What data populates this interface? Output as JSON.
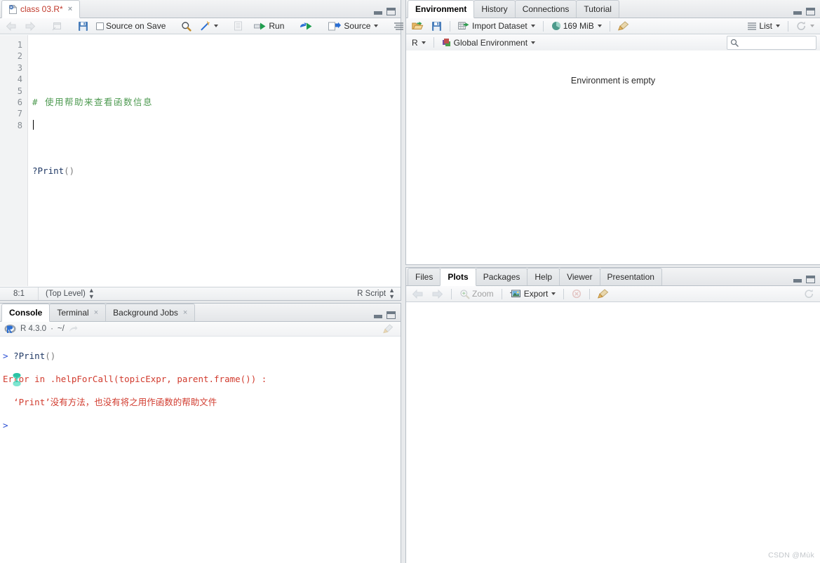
{
  "source": {
    "tab": {
      "label": "class 03.R*",
      "icon": "r-file-icon",
      "close": "×"
    },
    "toolbar": {
      "back": "back-arrow",
      "forward": "forward-arrow",
      "popout": "show-in-new-window",
      "save": "save-icon",
      "source_on_save_label": "Source on Save",
      "find": "magnifier-icon",
      "codetools": "magic-wand-icon",
      "compile_report": "compile-report-icon",
      "run_label": "Run",
      "rerun": "rerun-icon",
      "source_label": "Source",
      "outline": "outline-icon"
    },
    "gutter_lines": [
      "1",
      "2",
      "3",
      "4",
      "5",
      "6",
      "7",
      "8"
    ],
    "code": {
      "line2_comment": "# 使用帮助来查看函数信息",
      "line4_fn": "?Print",
      "line4_paren": "()"
    },
    "status": {
      "position": "8:1",
      "scope": "(Top Level)",
      "filetype": "R Script"
    }
  },
  "console": {
    "tabs": [
      {
        "label": "Console",
        "active": true,
        "closable": false
      },
      {
        "label": "Terminal",
        "active": false,
        "closable": true
      },
      {
        "label": "Background Jobs",
        "active": false,
        "closable": true
      }
    ],
    "header": {
      "logo": "r-logo-icon",
      "version": "R 4.3.0",
      "sep": "·",
      "path": "~/",
      "popout": "open-in-window-icon",
      "broom": "clear-console-icon"
    },
    "output": {
      "prompt1": ">",
      "input1_fn": "?Print",
      "input1_paren": "()",
      "error_line1": "Error in .helpForCall(topicExpr, parent.frame()) :",
      "error_line2": "  ‘Print’没有方法，也没有将之用作函数的帮助文件",
      "prompt2": ">"
    }
  },
  "environment": {
    "tabs": [
      {
        "label": "Environment",
        "active": true
      },
      {
        "label": "History",
        "active": false
      },
      {
        "label": "Connections",
        "active": false
      },
      {
        "label": "Tutorial",
        "active": false
      }
    ],
    "toolbar": {
      "load": "open-folder-icon",
      "save": "save-icon",
      "import_label": "Import Dataset",
      "memory_label": "169 MiB",
      "memory_icon": "memory-pie-icon",
      "broom": "clear-objects-icon",
      "list_label": "List",
      "list_icon": "list-view-icon",
      "refresh": "refresh-icon"
    },
    "scope": {
      "language": "R",
      "env_label": "Global Environment",
      "env_icon": "cube-icon"
    },
    "search_placeholder": "",
    "search_value": "",
    "empty_message": "Environment is empty"
  },
  "plots": {
    "tabs": [
      {
        "label": "Files",
        "active": false
      },
      {
        "label": "Plots",
        "active": true
      },
      {
        "label": "Packages",
        "active": false
      },
      {
        "label": "Help",
        "active": false
      },
      {
        "label": "Viewer",
        "active": false
      },
      {
        "label": "Presentation",
        "active": false
      }
    ],
    "toolbar": {
      "back": "back-arrow",
      "forward": "forward-arrow",
      "zoom_label": "Zoom",
      "export_label": "Export",
      "remove": "remove-plot-icon",
      "clear_all": "clear-plots-icon",
      "refresh": "refresh-icon"
    }
  },
  "watermark": "CSDN @Mùk",
  "colors": {
    "comment": "#4e9a51",
    "code": "#1f3864",
    "error": "#d13b2e",
    "prompt": "#2b4fd4",
    "tab_active_text": "#c0392b"
  }
}
